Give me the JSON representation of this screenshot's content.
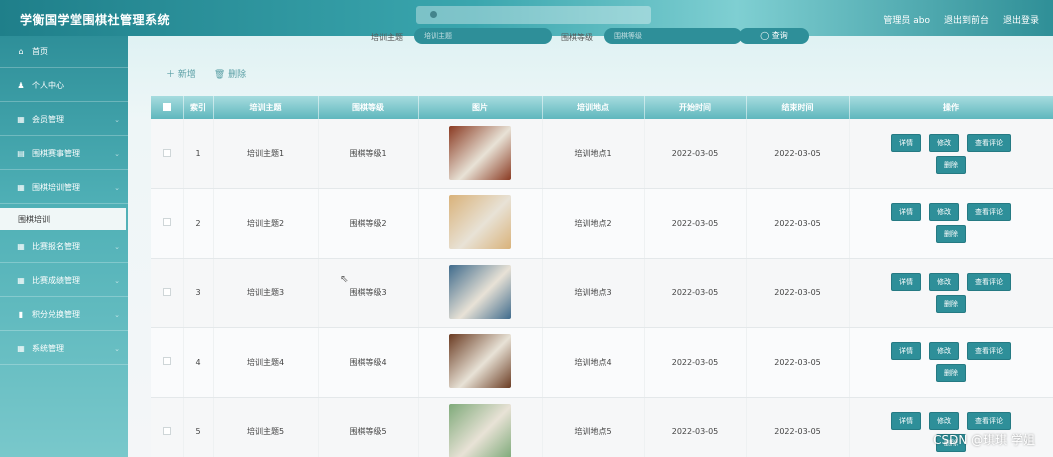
{
  "app": {
    "title": "学衡国学堂围棋社管理系统",
    "user_label": "管理员 abo",
    "to_front": "退出到前台",
    "logout": "退出登录"
  },
  "sidebar": {
    "items": [
      {
        "icon": "home-icon",
        "glyph": "⌂",
        "label": "首页"
      },
      {
        "icon": "user-icon",
        "glyph": "♟",
        "label": "个人中心"
      },
      {
        "icon": "member-icon",
        "glyph": "▦",
        "label": "会员管理"
      },
      {
        "icon": "event-icon",
        "glyph": "▤",
        "label": "围棋赛事管理"
      },
      {
        "icon": "training-icon",
        "glyph": "▦",
        "label": "围棋培训管理"
      },
      {
        "icon": "signup-icon",
        "glyph": "▦",
        "label": "比赛报名管理"
      },
      {
        "icon": "score-icon",
        "glyph": "▦",
        "label": "比赛成绩管理"
      },
      {
        "icon": "points-icon",
        "glyph": "▮",
        "label": "积分兑换管理"
      },
      {
        "icon": "system-icon",
        "glyph": "▦",
        "label": "系统管理"
      }
    ],
    "sub_item": "围棋培训"
  },
  "search": {
    "field1_label": "培训主题",
    "field1_placeholder": "培训主题",
    "field2_label": "围棋等级",
    "field2_placeholder": "围棋等级",
    "button_label": "◯ 查询"
  },
  "toolbar": {
    "add_label": "＋ 新增",
    "delete_label": "🗑 删除"
  },
  "table": {
    "headers": [
      "",
      "索引",
      "培训主题",
      "围棋等级",
      "图片",
      "培训地点",
      "开始时间",
      "结束时间",
      "操作"
    ],
    "op_labels": {
      "detail": "详情",
      "edit": "修改",
      "comments": "查看评论",
      "delete": "删除"
    },
    "rows": [
      {
        "index": "1",
        "topic": "培训主题1",
        "level": "围棋等级1",
        "place": "培训地点1",
        "start": "2022-03-05",
        "end": "2022-03-05",
        "img_color": "#8a3a22"
      },
      {
        "index": "2",
        "topic": "培训主题2",
        "level": "围棋等级2",
        "place": "培训地点2",
        "start": "2022-03-05",
        "end": "2022-03-05",
        "img_color": "#d9b27a"
      },
      {
        "index": "3",
        "topic": "培训主题3",
        "level": "围棋等级3",
        "place": "培训地点3",
        "start": "2022-03-05",
        "end": "2022-03-05",
        "img_color": "#3f6b8c"
      },
      {
        "index": "4",
        "topic": "培训主题4",
        "level": "围棋等级4",
        "place": "培训地点4",
        "start": "2022-03-05",
        "end": "2022-03-05",
        "img_color": "#6a3b22"
      },
      {
        "index": "5",
        "topic": "培训主题5",
        "level": "围棋等级5",
        "place": "培训地点5",
        "start": "2022-03-05",
        "end": "2022-03-05",
        "img_color": "#7faa7a"
      }
    ]
  },
  "watermark": "CSDN @琪琪 学姐"
}
